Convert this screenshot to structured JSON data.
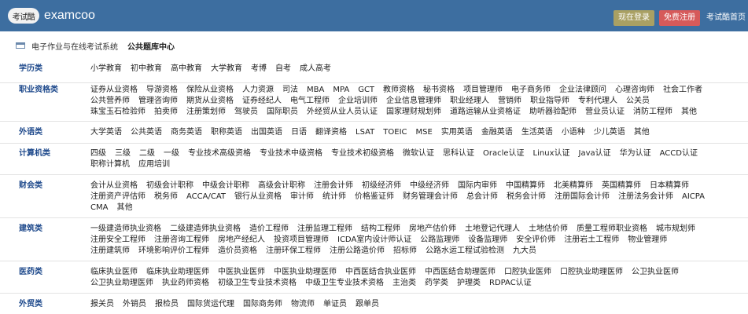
{
  "header": {
    "logo_badge": "考试酷",
    "logo_text": "examcoo",
    "login_label": "现在登录",
    "register_label": "免费注册",
    "user_link": "考试酷首页"
  },
  "breadcrumb": {
    "parent": "电子作业与在线考试系统",
    "current": "公共题库中心"
  },
  "categories": [
    {
      "title": "学历类",
      "items": [
        "小学教育",
        "初中教育",
        "高中教育",
        "大学教育",
        "考博",
        "自考",
        "成人高考"
      ]
    },
    {
      "title": "职业资格类",
      "items": [
        "证券从业资格",
        "导游资格",
        "保险从业资格",
        "人力资源",
        "司法",
        "MBA",
        "MPA",
        "GCT",
        "教师资格",
        "秘书资格",
        "项目管理师",
        "电子商务师",
        "企业法律顾问",
        "心理咨询师",
        "社会工作者",
        "公共营养师",
        "管理咨询师",
        "期货从业资格",
        "证券经纪人",
        "电气工程师",
        "企业培训师",
        "企业信息管理师",
        "职业经理人",
        "营销师",
        "职业指导师",
        "专利代理人",
        "公关员",
        "珠宝玉石检验师",
        "拍卖师",
        "注册策划师",
        "驾驶员",
        "国际职员",
        "外经贸从业人员认证",
        "国家理财规划师",
        "道路运输从业资格证",
        "助听器验配师",
        "营业员认证",
        "消防工程师",
        "其他"
      ]
    },
    {
      "title": "外语类",
      "items": [
        "大学英语",
        "公共英语",
        "商务英语",
        "职称英语",
        "出国英语",
        "日语",
        "翻译资格",
        "LSAT",
        "TOEIC",
        "MSE",
        "实用英语",
        "金融英语",
        "生活英语",
        "小语种",
        "少儿英语",
        "其他"
      ]
    },
    {
      "title": "计算机类",
      "items": [
        "四级",
        "三级",
        "二级",
        "一级",
        "专业技术高级资格",
        "专业技术中级资格",
        "专业技术初级资格",
        "微软认证",
        "思科认证",
        "Oracle认证",
        "Linux认证",
        "Java认证",
        "华为认证",
        "ACCD认证",
        "职称计算机",
        "应用培训"
      ]
    },
    {
      "title": "财会类",
      "items": [
        "会计从业资格",
        "初级会计职称",
        "中级会计职称",
        "高级会计职称",
        "注册会计师",
        "初级经济师",
        "中级经济师",
        "国际内审师",
        "中国精算师",
        "北美精算师",
        "英国精算师",
        "日本精算师",
        "注册资产评估师",
        "税务师",
        "ACCA/CAT",
        "银行从业资格",
        "审计师",
        "统计师",
        "价格鉴证师",
        "财务管理会计师",
        "总会计师",
        "税务会计师",
        "注册国际会计师",
        "注册法务会计师",
        "AICPA",
        "CMA",
        "其他"
      ]
    },
    {
      "title": "建筑类",
      "items": [
        "一级建造师执业资格",
        "二级建造师执业资格",
        "造价工程师",
        "注册监理工程师",
        "结构工程师",
        "房地产估价师",
        "土地登记代理人",
        "土地估价师",
        "质量工程师职业资格",
        "城市规划师",
        "注册安全工程师",
        "注册咨询工程师",
        "房地产经纪人",
        "投资项目管理师",
        "ICDA室内设计师认证",
        "公路监理师",
        "设备监理师",
        "安全评价师",
        "注册岩土工程师",
        "物业管理师",
        "注册建筑师",
        "环境影响评价工程师",
        "造价员资格",
        "注册环保工程师",
        "注册公路造价师",
        "招标师",
        "公路水运工程试验检测",
        "九大员"
      ]
    },
    {
      "title": "医药类",
      "items": [
        "临床执业医师",
        "临床执业助理医师",
        "中医执业医师",
        "中医执业助理医师",
        "中西医结合执业医师",
        "中西医结合助理医师",
        "口腔执业医师",
        "口腔执业助理医师",
        "公卫执业医师",
        "公卫执业助理医师",
        "执业药师资格",
        "初级卫生专业技术资格",
        "中级卫生专业技术资格",
        "主治类",
        "药学类",
        "护理类",
        "RDPAC认证"
      ]
    },
    {
      "title": "外贸类",
      "items": [
        "报关员",
        "外销员",
        "报检员",
        "国际货运代理",
        "国际商务师",
        "物流师",
        "单证员",
        "跟单员"
      ]
    }
  ]
}
